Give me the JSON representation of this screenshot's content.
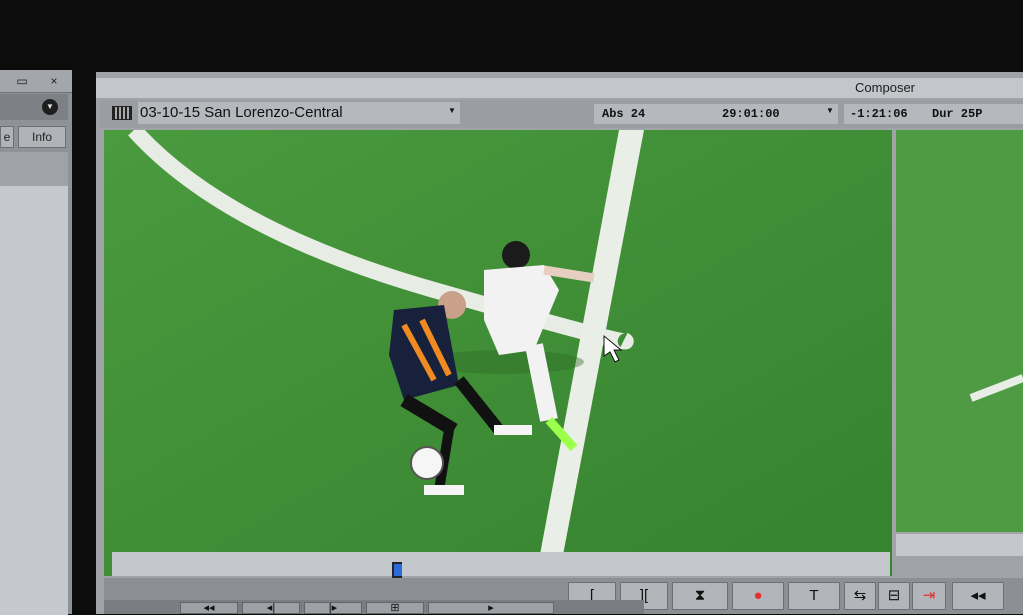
{
  "left_panel": {
    "tabs": [
      "e",
      "Info"
    ],
    "window_buttons": [
      "▭",
      "×"
    ]
  },
  "composer": {
    "title": "Composer",
    "clip_name": "03-10-15 San Lorenzo-Central",
    "timecodes": {
      "abs": "Abs 24",
      "tc": "29:01:00",
      "remain": "-1:21:06",
      "dur": "Dur 25P"
    }
  },
  "controls": {
    "buttons": [
      "[",
      "][",
      "⧗",
      "●",
      "T",
      "⇆",
      "⊟",
      "⇥",
      "◂◂"
    ],
    "transport": [
      "◂◂",
      "◂|",
      "|▸",
      "⊞",
      "▸"
    ]
  },
  "colors": {
    "grass": "#3d8c34",
    "panel": "#a0a3a7",
    "record": "#e53030"
  }
}
